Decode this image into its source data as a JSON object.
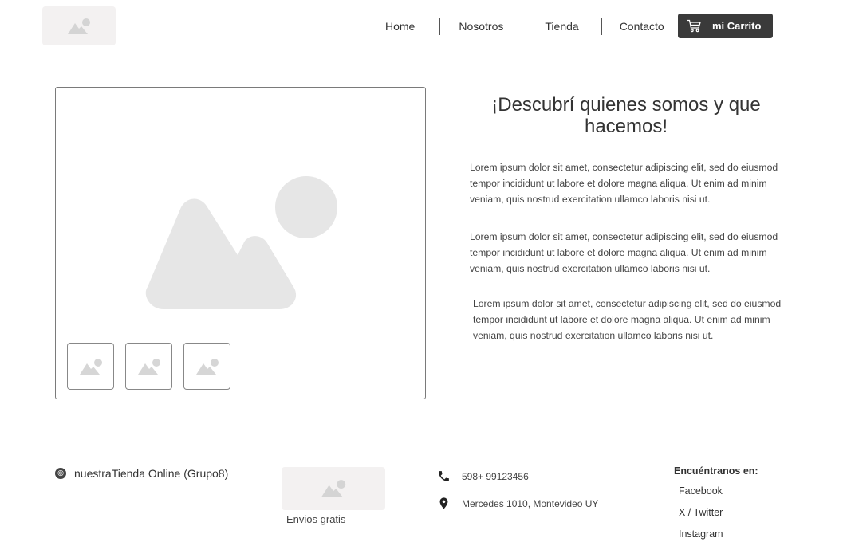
{
  "header": {
    "logo_icon": "image-placeholder-icon",
    "nav": [
      "Home",
      "Nosotros",
      "Tienda",
      "Contacto"
    ],
    "cart_label": "mi Carrito",
    "cart_icon": "cart-icon"
  },
  "gallery": {
    "main_icon": "image-placeholder-icon",
    "thumbnail_icon": "image-placeholder-icon",
    "thumbnail_count": 3
  },
  "content": {
    "title": "¡Descubrí quienes somos y que hacemos!",
    "paragraphs": [
      "Lorem ipsum dolor sit amet, consectetur adipiscing elit, sed do eiusmod tempor incididunt ut labore et dolore magna aliqua. Ut enim ad minim veniam, quis nostrud exercitation ullamco laboris nisi ut.",
      "Lorem ipsum dolor sit amet, consectetur adipiscing elit, sed do eiusmod tempor incididunt ut labore et dolore magna aliqua. Ut enim ad minim veniam, quis nostrud exercitation ullamco laboris nisi ut.",
      "Lorem ipsum dolor sit amet, consectetur adipiscing elit, sed do eiusmod tempor incididunt ut labore et dolore magna aliqua. Ut enim ad minim veniam, quis nostrud exercitation ullamco laboris nisi ut."
    ]
  },
  "footer": {
    "brand": "nuestraTienda Online (Grupo8)",
    "brand_icon": "copyright-icon",
    "envios": "Envios gratis",
    "phone": "598+ 99123456",
    "phone_icon": "phone-icon",
    "address": "Mercedes 1010, Montevideo UY",
    "address_icon": "location-pin-icon",
    "follow_title": "Encuéntranos en:",
    "social": [
      "Facebook",
      "X / Twitter",
      "Instagram"
    ]
  },
  "colors": {
    "placeholder_bg": "#f3f1f1",
    "placeholder_art": "#e6e6e6",
    "cart_button_bg": "#3a3a3a",
    "border": "#7a7a7a"
  }
}
